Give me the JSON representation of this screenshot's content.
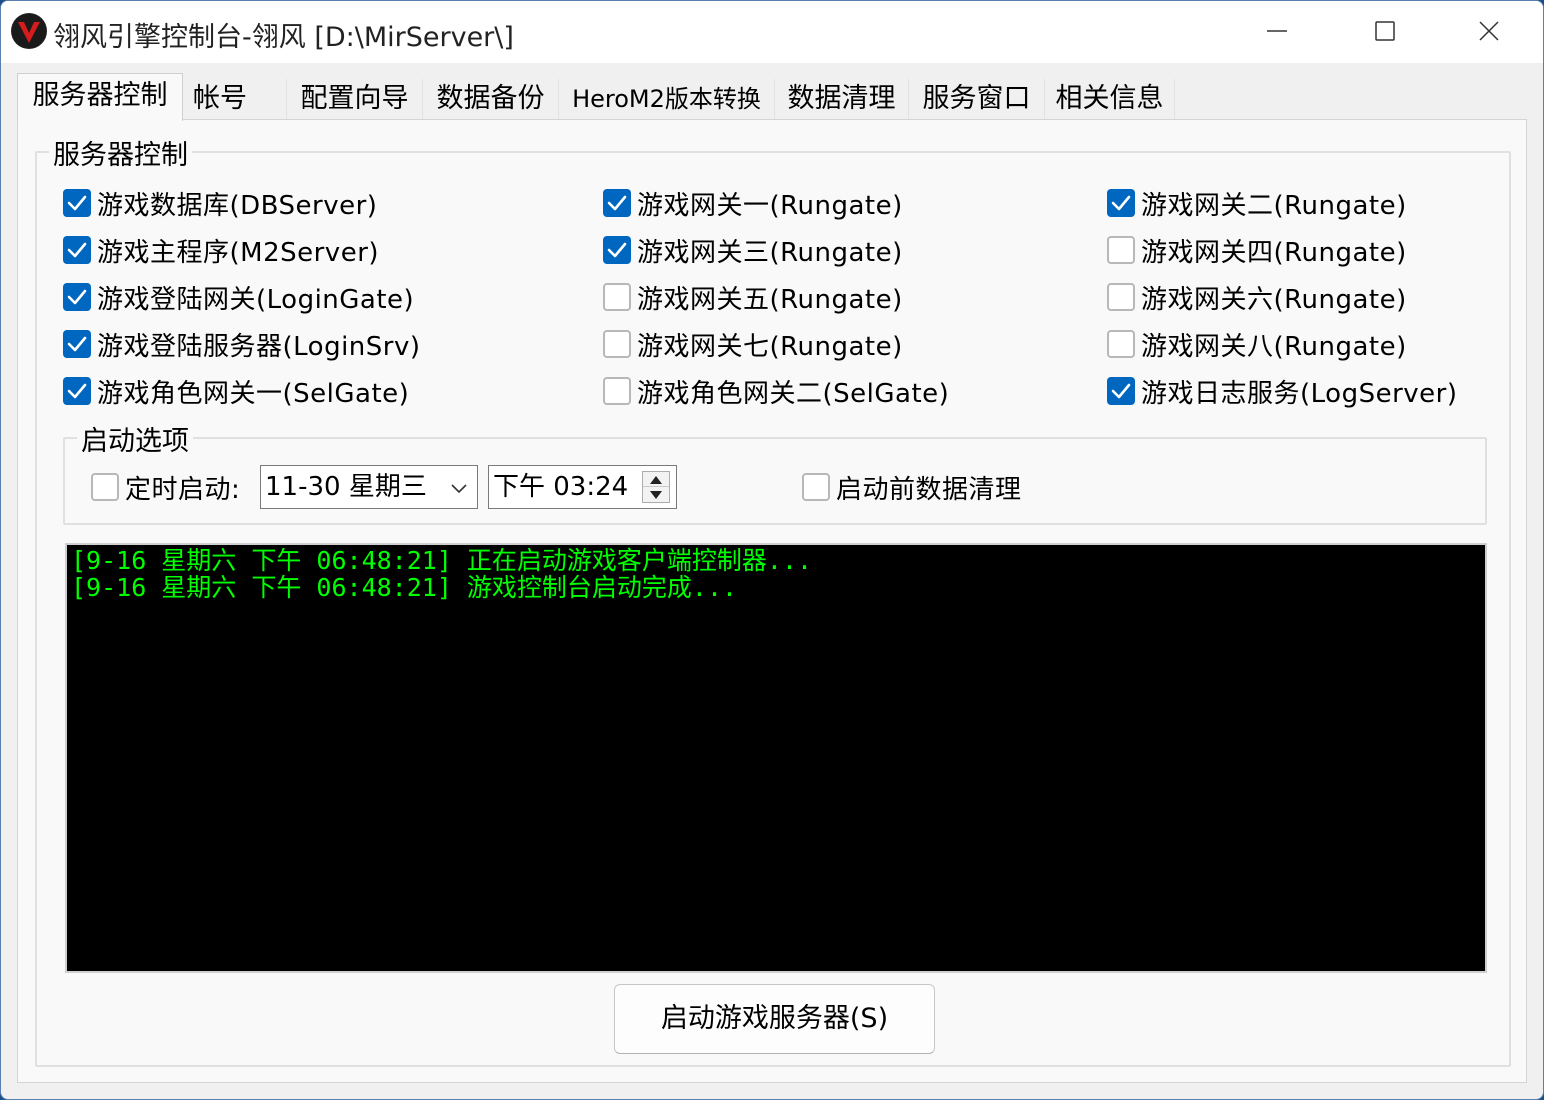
{
  "window": {
    "title": "翎风引擎控制台-翎风 [D:\\MirServer\\]"
  },
  "tabs": [
    {
      "label": "服务器控制",
      "active": true
    },
    {
      "label": "帐号",
      "active": false
    },
    {
      "label": "配置向导",
      "active": false
    },
    {
      "label": "数据备份",
      "active": false
    },
    {
      "label": "HeroM2版本转换",
      "active": false
    },
    {
      "label": "数据清理",
      "active": false
    },
    {
      "label": "服务窗口",
      "active": false
    },
    {
      "label": "相关信息",
      "active": false
    }
  ],
  "server_control": {
    "group_title": "服务器控制",
    "checkboxes": [
      {
        "label": "游戏数据库(DBServer)",
        "checked": true
      },
      {
        "label": "游戏网关一(Rungate)",
        "checked": true
      },
      {
        "label": "游戏网关二(Rungate)",
        "checked": true
      },
      {
        "label": "游戏主程序(M2Server)",
        "checked": true
      },
      {
        "label": "游戏网关三(Rungate)",
        "checked": true
      },
      {
        "label": "游戏网关四(Rungate)",
        "checked": false
      },
      {
        "label": "游戏登陆网关(LoginGate)",
        "checked": true
      },
      {
        "label": "游戏网关五(Rungate)",
        "checked": false
      },
      {
        "label": "游戏网关六(Rungate)",
        "checked": false
      },
      {
        "label": "游戏登陆服务器(LoginSrv)",
        "checked": true
      },
      {
        "label": "游戏网关七(Rungate)",
        "checked": false
      },
      {
        "label": "游戏网关八(Rungate)",
        "checked": false
      },
      {
        "label": "游戏角色网关一(SelGate)",
        "checked": true
      },
      {
        "label": "游戏角色网关二(SelGate)",
        "checked": false
      },
      {
        "label": "游戏日志服务(LogServer)",
        "checked": true
      }
    ]
  },
  "startup_options": {
    "group_title": "启动选项",
    "timed_start": {
      "label": "定时启动:",
      "checked": false
    },
    "date_value": "11-30  星期三",
    "time_value": "下午  03:24",
    "clean_before_start": {
      "label": "启动前数据清理",
      "checked": false
    }
  },
  "console": {
    "lines": [
      "[9-16 星期六 下午 06:48:21] 正在启动游戏客户端控制器...",
      "[9-16 星期六 下午 06:48:21] 游戏控制台启动完成..."
    ],
    "text_color": "#00ff00",
    "background": "#000000"
  },
  "start_button": {
    "label": "启动游戏服务器(S)"
  },
  "colors": {
    "accent": "#0067c0"
  }
}
